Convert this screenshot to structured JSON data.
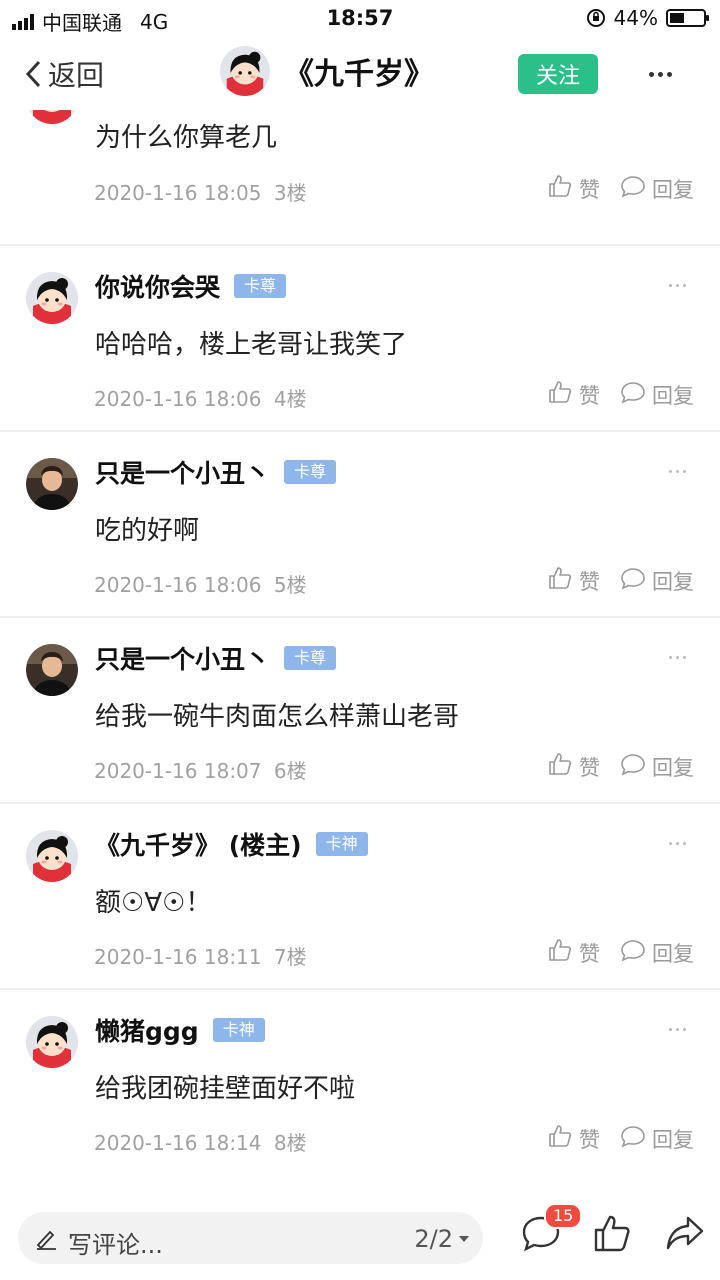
{
  "status_bar": {
    "carrier": "中国联通",
    "network": "4G",
    "time": "18:57",
    "battery": "44%",
    "battery_level": 0.44
  },
  "nav": {
    "back_label": "返回",
    "title": "《九千岁》",
    "follow_label": "关注",
    "more_icon": "more-horizontal-icon"
  },
  "actions_text": {
    "like": "赞",
    "reply": "回复"
  },
  "comments": [
    {
      "author": "",
      "badge": "",
      "avatar": "cartoon-girl",
      "content": "为什么你算老几",
      "date": "2020-1-16 18:05",
      "floor": "3楼"
    },
    {
      "author": "你说你会哭",
      "badge": "卡尊",
      "avatar": "cartoon-girl",
      "content": "哈哈哈，楼上老哥让我笑了",
      "date": "2020-1-16 18:06",
      "floor": "4楼"
    },
    {
      "author": "只是一个小丑丶",
      "badge": "卡尊",
      "avatar": "photo-man",
      "content": "吃的好啊",
      "date": "2020-1-16 18:06",
      "floor": "5楼"
    },
    {
      "author": "只是一个小丑丶",
      "badge": "卡尊",
      "avatar": "photo-man",
      "content": "给我一碗牛肉面怎么样萧山老哥",
      "date": "2020-1-16 18:07",
      "floor": "6楼"
    },
    {
      "author": "《九千岁》 (楼主)",
      "badge": "卡神",
      "avatar": "cartoon-girl",
      "content": "额☉∀☉！",
      "date": "2020-1-16 18:11",
      "floor": "7楼"
    },
    {
      "author": "懒猪ggg",
      "badge": "卡神",
      "avatar": "cartoon-girl",
      "content": "给我团碗挂壁面好不啦",
      "date": "2020-1-16 18:14",
      "floor": "8楼"
    }
  ],
  "bottom_bar": {
    "placeholder": "写评论...",
    "page": "2/2",
    "comment_count": "15"
  },
  "colors": {
    "accent": "#2bbf8a",
    "badge": "#8fb6ea",
    "notification": "#f04b3e"
  }
}
